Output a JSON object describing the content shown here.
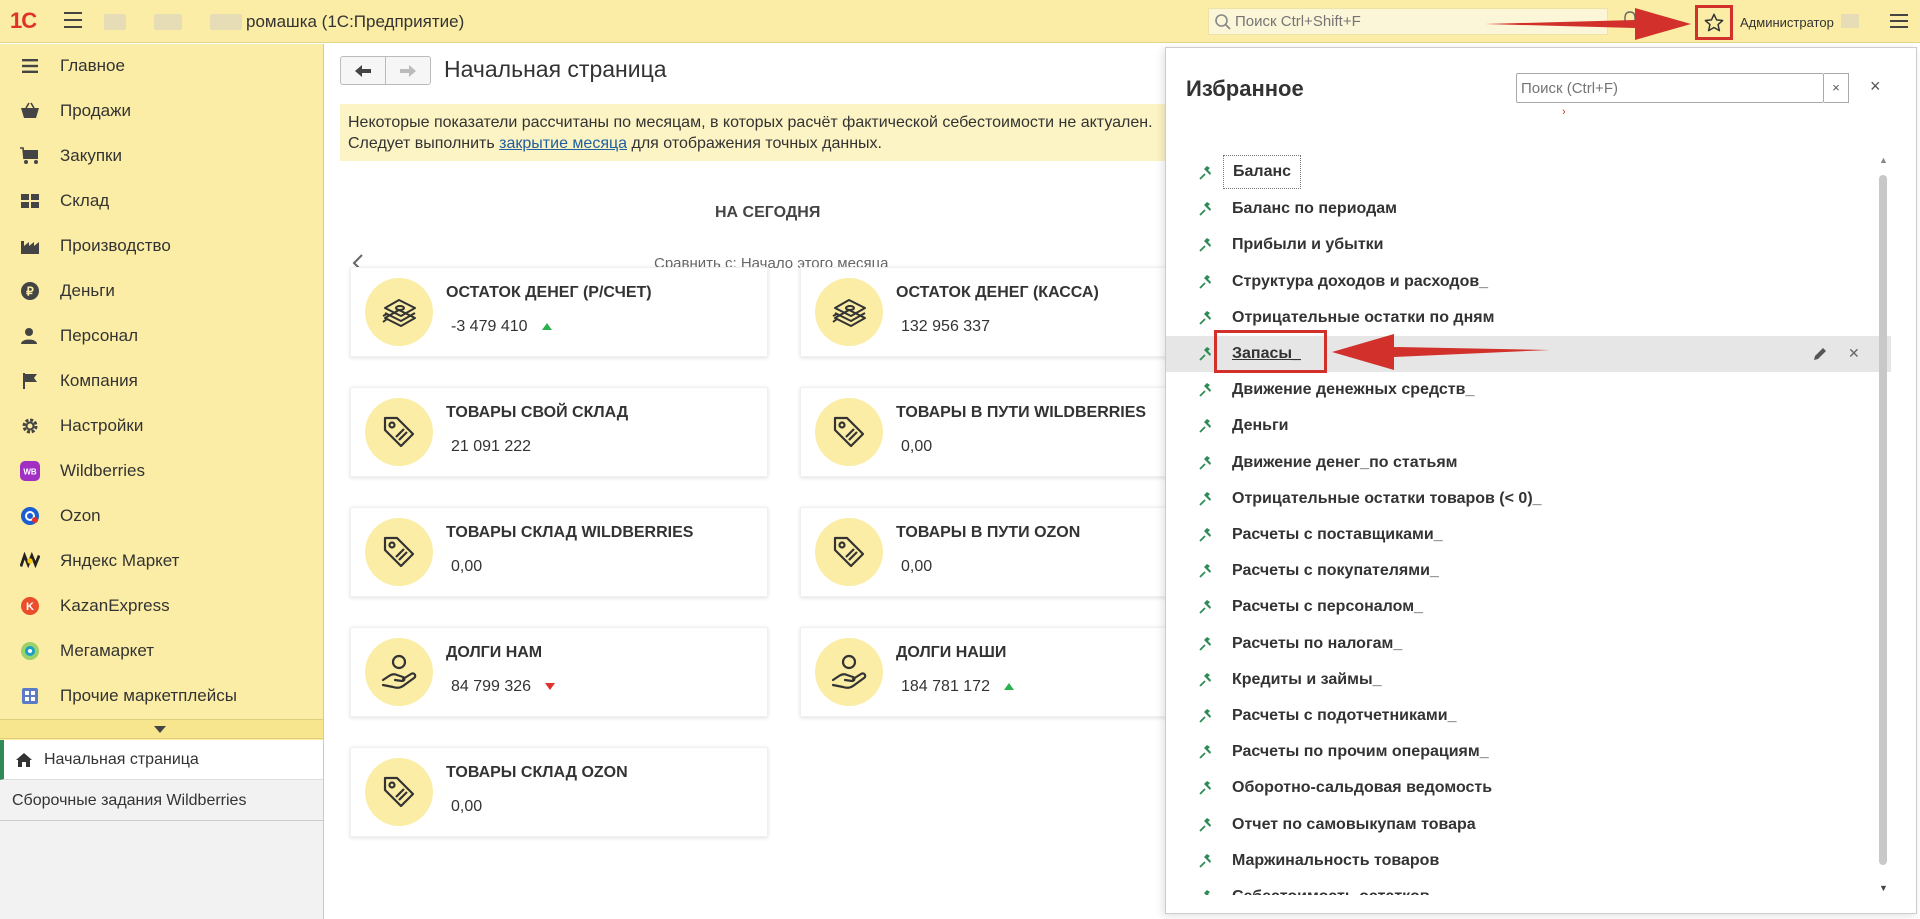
{
  "topbar": {
    "logo": "1С",
    "app_title": "ромашка  (1С:Предприятие)",
    "search_placeholder": "Поиск Ctrl+Shift+F",
    "user": "Администратор"
  },
  "sidebar": {
    "items": [
      {
        "label": "Главное",
        "icon": "list-icon"
      },
      {
        "label": "Продажи",
        "icon": "basket-icon"
      },
      {
        "label": "Закупки",
        "icon": "cart-icon"
      },
      {
        "label": "Склад",
        "icon": "warehouse-icon"
      },
      {
        "label": "Производство",
        "icon": "factory-icon"
      },
      {
        "label": "Деньги",
        "icon": "ruble-icon"
      },
      {
        "label": "Персонал",
        "icon": "person-icon"
      },
      {
        "label": "Компания",
        "icon": "flag-icon"
      },
      {
        "label": "Настройки",
        "icon": "gear-icon"
      },
      {
        "label": "Wildberries",
        "icon": "wildberries-icon",
        "badge": "WB"
      },
      {
        "label": "Ozon",
        "icon": "ozon-icon"
      },
      {
        "label": "Яндекс Маркет",
        "icon": "yandex-market-icon"
      },
      {
        "label": "KazanExpress",
        "icon": "kazanexpress-icon",
        "badge": "K"
      },
      {
        "label": "Мегамаркет",
        "icon": "megamarket-icon"
      },
      {
        "label": "Прочие маркетплейсы",
        "icon": "marketplaces-icon"
      }
    ],
    "open_tabs": [
      "Начальная страница",
      "Сборочные задания Wildberries"
    ]
  },
  "main": {
    "title": "Начальная страница",
    "notice_line1": "Некоторые показатели рассчитаны по месяцам, в которых расчёт фактической себестоимости не актуален.",
    "notice_line2_before": "Следует выполнить ",
    "notice_link": "закрытие месяца",
    "notice_line2_after": " для отображения точных данных.",
    "today_label": "НА СЕГОДНЯ",
    "compare_label": "Сравнить с: Начало этого месяца",
    "cards": [
      {
        "title": "ОСТАТОК ДЕНЕГ (Р/СЧЕТ)",
        "value": "-3 479 410",
        "trend": "up",
        "icon": "money-icon"
      },
      {
        "title": "ОСТАТОК ДЕНЕГ (КАССА)",
        "value": "132 956 337",
        "trend": "none",
        "icon": "money-icon"
      },
      {
        "title": "ТОВАРЫ СВОЙ СКЛАД",
        "value": "21 091 222",
        "trend": "none",
        "icon": "tag-icon"
      },
      {
        "title": "ТОВАРЫ В ПУТИ WILDBERRIES",
        "value": "0,00",
        "trend": "none",
        "icon": "tag-icon"
      },
      {
        "title": "ТОВАРЫ СКЛАД WILDBERRIES",
        "value": "0,00",
        "trend": "none",
        "icon": "tag-icon"
      },
      {
        "title": "ТОВАРЫ В ПУТИ OZON",
        "value": "0,00",
        "trend": "none",
        "icon": "tag-icon"
      },
      {
        "title": "ДОЛГИ НАМ",
        "value": "84 799 326",
        "trend": "down",
        "icon": "hand-icon"
      },
      {
        "title": "ДОЛГИ НАШИ",
        "value": "184 781 172",
        "trend": "up",
        "icon": "hand-icon"
      },
      {
        "title": "ТОВАРЫ СКЛАД OZON",
        "value": "0,00",
        "trend": "none",
        "icon": "tag-icon"
      }
    ]
  },
  "favorites": {
    "title": "Избранное",
    "search_placeholder": "Поиск (Ctrl+F)",
    "clear_label": "×",
    "close_label": "×",
    "items": [
      "Баланс",
      "Баланс по периодам",
      "Прибыли и убытки",
      "Структура доходов и расходов_",
      "Отрицательные остатки по дням",
      "Запасы_",
      "Движение денежных средств_",
      "Деньги",
      "Движение денег_по статьям",
      "Отрицательные остатки товаров (< 0)_",
      "Расчеты с поставщиками_",
      "Расчеты с покупателями_",
      "Расчеты с персоналом_",
      "Расчеты по налогам_",
      "Кредиты и займы_",
      "Расчеты с подотчетниками_",
      "Расчеты по прочим операциям_",
      "Оборотно-сальдовая ведомость",
      "Отчет по самовыкупам товара",
      "Маржинальность товаров",
      "Себестоимость остатков"
    ],
    "focused_index": 0,
    "highlighted_index": 5
  },
  "colors": {
    "accent_yellow": "#fbeda5",
    "annotation_red": "#d2312b",
    "pin_green": "#2e8b57"
  }
}
